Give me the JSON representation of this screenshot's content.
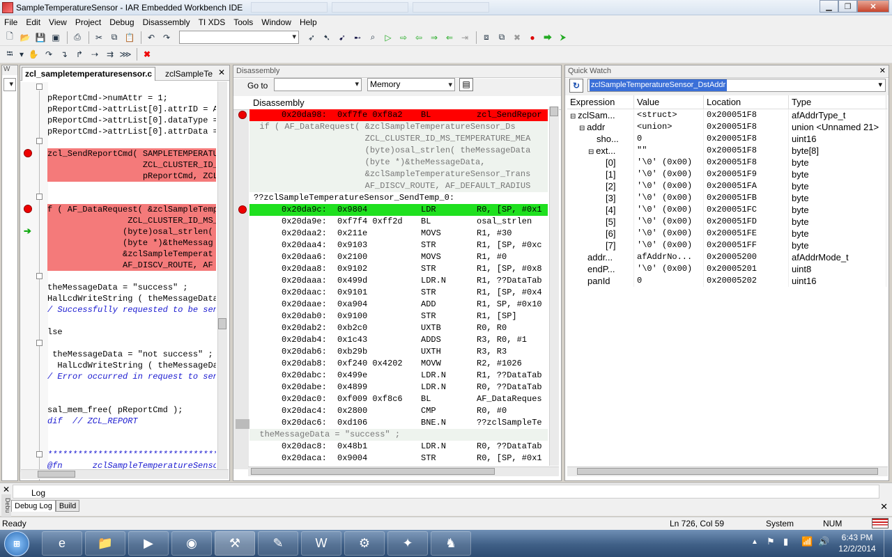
{
  "window": {
    "title": "SampleTemperatureSensor - IAR Embedded Workbench IDE",
    "minimize": "▁",
    "restore": "❐",
    "close": "✕"
  },
  "menu": [
    "File",
    "Edit",
    "View",
    "Project",
    "Debug",
    "Disassembly",
    "TI XDS",
    "Tools",
    "Window",
    "Help"
  ],
  "editor": {
    "tabs": [
      "zcl_sampletemperaturesensor.c",
      "zclSampleTe"
    ],
    "close_glyph": "✕",
    "lines": [
      {
        "text": "pReportCmd->numAttr = 1;",
        "style": "normal"
      },
      {
        "text": "pReportCmd->attrList[0].attrID = A",
        "style": "normal"
      },
      {
        "text": "pReportCmd->attrList[0].dataType =",
        "style": "normal"
      },
      {
        "text": "pReportCmd->attrList[0].attrData =",
        "style": "normal"
      },
      {
        "text": "",
        "style": "normal"
      },
      {
        "text": "zcl_SendReportCmd( SAMPLETEMPERATU",
        "style": "red"
      },
      {
        "text": "                   ZCL_CLUSTER_ID_",
        "style": "red2"
      },
      {
        "text": "                   pReportCmd, ZCL",
        "style": "red2"
      },
      {
        "text": "",
        "style": "normal"
      },
      {
        "text": "",
        "style": "normal"
      },
      {
        "text": "f ( AF_DataRequest( &zclSampleTempe",
        "style": "red"
      },
      {
        "text": "                ZCL_CLUSTER_ID_MS_",
        "style": "red2"
      },
      {
        "text": "               (byte)osal_strlen(",
        "style": "red2"
      },
      {
        "text": "               (byte *)&theMessag",
        "style": "red2"
      },
      {
        "text": "               &zclSampleTemperat",
        "style": "red2"
      },
      {
        "text": "               AF_DISCV_ROUTE, AF",
        "style": "red2"
      },
      {
        "text": "",
        "style": "normal"
      },
      {
        "text": "theMessageData = \"success\" ;",
        "style": "normal"
      },
      {
        "text": "HalLcdWriteString ( theMessageData",
        "style": "normal"
      },
      {
        "text": "/ Successfully requested to be sent",
        "style": "comment"
      },
      {
        "text": "",
        "style": "normal"
      },
      {
        "text": "lse",
        "style": "normal"
      },
      {
        "text": "",
        "style": "normal"
      },
      {
        "text": " theMessageData = \"not success\" ;",
        "style": "normal"
      },
      {
        "text": "  HalLcdWriteString ( theMessageDa",
        "style": "normal"
      },
      {
        "text": "/ Error occurred in request to send",
        "style": "comment"
      },
      {
        "text": "",
        "style": "normal"
      },
      {
        "text": "",
        "style": "normal"
      },
      {
        "text": "sal_mem_free( pReportCmd );",
        "style": "normal"
      },
      {
        "text": "dif  // ZCL_REPORT",
        "style": "comment"
      },
      {
        "text": "",
        "style": "normal"
      },
      {
        "text": "",
        "style": "normal"
      },
      {
        "text": "*************************************",
        "style": "comment"
      },
      {
        "text": "@fn      zclSampleTemperatureSensor",
        "style": "comment"
      }
    ]
  },
  "disassembly": {
    "panel_title": "Disassembly",
    "goto_label": "Go to",
    "memory_label": "Memory",
    "header": "Disassembly",
    "rows": [
      {
        "kind": "asm",
        "addr": "0x20da98:",
        "hex": "0xf7fe 0xf8a2",
        "mn": "BL",
        "op": "zcl_SendRepor",
        "hl": "red"
      },
      {
        "kind": "src",
        "text": "  if ( AF_DataRequest( &zclSampleTemperatureSensor_Ds"
      },
      {
        "kind": "src",
        "text": "                       ZCL_CLUSTER_ID_MS_TEMPERATURE_MEA"
      },
      {
        "kind": "src",
        "text": "                       (byte)osal_strlen( theMessageData"
      },
      {
        "kind": "src",
        "text": "                       (byte *)&theMessageData,"
      },
      {
        "kind": "src",
        "text": "                       &zclSampleTemperatureSensor_Trans"
      },
      {
        "kind": "src",
        "text": "                       AF_DISCV_ROUTE, AF_DEFAULT_RADIUS"
      },
      {
        "kind": "label",
        "text": "??zclSampleTemperatureSensor_SendTemp_0:"
      },
      {
        "kind": "asm",
        "addr": "0x20da9c:",
        "hex": "0x9804",
        "mn": "LDR",
        "op": "R0, [SP, #0x1",
        "hl": "green"
      },
      {
        "kind": "asm",
        "addr": "0x20da9e:",
        "hex": "0xf7f4 0xff2d",
        "mn": "BL",
        "op": "osal_strlen"
      },
      {
        "kind": "asm",
        "addr": "0x20daa2:",
        "hex": "0x211e",
        "mn": "MOVS",
        "op": "R1, #30"
      },
      {
        "kind": "asm",
        "addr": "0x20daa4:",
        "hex": "0x9103",
        "mn": "STR",
        "op": "R1, [SP, #0xc"
      },
      {
        "kind": "asm",
        "addr": "0x20daa6:",
        "hex": "0x2100",
        "mn": "MOVS",
        "op": "R1, #0"
      },
      {
        "kind": "asm",
        "addr": "0x20daa8:",
        "hex": "0x9102",
        "mn": "STR",
        "op": "R1, [SP, #0x8"
      },
      {
        "kind": "asm",
        "addr": "0x20daaa:",
        "hex": "0x499d",
        "mn": "LDR.N",
        "op": "R1, ??DataTab"
      },
      {
        "kind": "asm",
        "addr": "0x20daac:",
        "hex": "0x9101",
        "mn": "STR",
        "op": "R1, [SP, #0x4"
      },
      {
        "kind": "asm",
        "addr": "0x20daae:",
        "hex": "0xa904",
        "mn": "ADD",
        "op": "R1, SP, #0x10"
      },
      {
        "kind": "asm",
        "addr": "0x20dab0:",
        "hex": "0x9100",
        "mn": "STR",
        "op": "R1, [SP]"
      },
      {
        "kind": "asm",
        "addr": "0x20dab2:",
        "hex": "0xb2c0",
        "mn": "UXTB",
        "op": "R0, R0"
      },
      {
        "kind": "asm",
        "addr": "0x20dab4:",
        "hex": "0x1c43",
        "mn": "ADDS",
        "op": "R3, R0, #1"
      },
      {
        "kind": "asm",
        "addr": "0x20dab6:",
        "hex": "0xb29b",
        "mn": "UXTH",
        "op": "R3, R3"
      },
      {
        "kind": "asm",
        "addr": "0x20dab8:",
        "hex": "0xf240 0x4202",
        "mn": "MOVW",
        "op": "R2, #1026"
      },
      {
        "kind": "asm",
        "addr": "0x20dabc:",
        "hex": "0x499e",
        "mn": "LDR.N",
        "op": "R1, ??DataTab"
      },
      {
        "kind": "asm",
        "addr": "0x20dabe:",
        "hex": "0x4899",
        "mn": "LDR.N",
        "op": "R0, ??DataTab"
      },
      {
        "kind": "asm",
        "addr": "0x20dac0:",
        "hex": "0xf009 0xf8c6",
        "mn": "BL",
        "op": "AF_DataReques"
      },
      {
        "kind": "asm",
        "addr": "0x20dac4:",
        "hex": "0x2800",
        "mn": "CMP",
        "op": "R0, #0"
      },
      {
        "kind": "asm",
        "addr": "0x20dac6:",
        "hex": "0xd106",
        "mn": "BNE.N",
        "op": "??zclSampleTe"
      },
      {
        "kind": "src",
        "text": "  theMessageData = \"success\" ;"
      },
      {
        "kind": "asm",
        "addr": "0x20dac8:",
        "hex": "0x48b1",
        "mn": "LDR.N",
        "op": "R0, ??DataTab"
      },
      {
        "kind": "asm",
        "addr": "0x20daca:",
        "hex": "0x9004",
        "mn": "STR",
        "op": "R0, [SP, #0x1"
      }
    ]
  },
  "quickwatch": {
    "panel_title": "Quick Watch",
    "expression_input": "zclSampleTemperatureSensor_DstAddr",
    "columns": [
      "Expression",
      "Value",
      "Location",
      "Type"
    ],
    "rows": [
      {
        "expr": "zclSam...",
        "value": "<struct>",
        "loc": "0x200051F8",
        "type": "afAddrType_t",
        "indent": 0,
        "tree": "⊟"
      },
      {
        "expr": "addr",
        "value": "<union>",
        "loc": "0x200051F8",
        "type": "union <Unnamed 21>",
        "indent": 1,
        "tree": "⊟"
      },
      {
        "expr": "sho...",
        "value": "0",
        "loc": "0x200051F8",
        "type": "uint16",
        "indent": 2,
        "tree": ""
      },
      {
        "expr": "ext...",
        "value": "\"\"",
        "loc": "0x200051F8",
        "type": "byte[8]",
        "indent": 2,
        "tree": "⊟"
      },
      {
        "expr": "[0]",
        "value": "'\\0' (0x00)",
        "loc": "0x200051F8",
        "type": "byte",
        "indent": 3,
        "tree": ""
      },
      {
        "expr": "[1]",
        "value": "'\\0' (0x00)",
        "loc": "0x200051F9",
        "type": "byte",
        "indent": 3,
        "tree": ""
      },
      {
        "expr": "[2]",
        "value": "'\\0' (0x00)",
        "loc": "0x200051FA",
        "type": "byte",
        "indent": 3,
        "tree": ""
      },
      {
        "expr": "[3]",
        "value": "'\\0' (0x00)",
        "loc": "0x200051FB",
        "type": "byte",
        "indent": 3,
        "tree": ""
      },
      {
        "expr": "[4]",
        "value": "'\\0' (0x00)",
        "loc": "0x200051FC",
        "type": "byte",
        "indent": 3,
        "tree": ""
      },
      {
        "expr": "[5]",
        "value": "'\\0' (0x00)",
        "loc": "0x200051FD",
        "type": "byte",
        "indent": 3,
        "tree": ""
      },
      {
        "expr": "[6]",
        "value": "'\\0' (0x00)",
        "loc": "0x200051FE",
        "type": "byte",
        "indent": 3,
        "tree": ""
      },
      {
        "expr": "[7]",
        "value": "'\\0' (0x00)",
        "loc": "0x200051FF",
        "type": "byte",
        "indent": 3,
        "tree": ""
      },
      {
        "expr": "addr...",
        "value": "afAddrNo...",
        "loc": "0x20005200",
        "type": "afAddrMode_t",
        "indent": 1,
        "tree": ""
      },
      {
        "expr": "endP...",
        "value": "'\\0' (0x00)",
        "loc": "0x20005201",
        "type": "uint8",
        "indent": 1,
        "tree": ""
      },
      {
        "expr": "panId",
        "value": "0",
        "loc": "0x20005202",
        "type": "uint16",
        "indent": 1,
        "tree": ""
      }
    ]
  },
  "bottom": {
    "tabs": [
      "Debug Log",
      "Build"
    ],
    "side_label": "Debu",
    "log_header": "Log",
    "close_glyph": "✕"
  },
  "status": {
    "left": "Ready",
    "position": "Ln 726, Col 59",
    "encoding": "System",
    "numlock": "NUM"
  },
  "clock": {
    "time": "6:43 PM",
    "date": "12/2/2014"
  },
  "colors": {
    "breakpoint": "#e00000",
    "current": "#1fe01f",
    "bp_line": "#f47a7a"
  }
}
